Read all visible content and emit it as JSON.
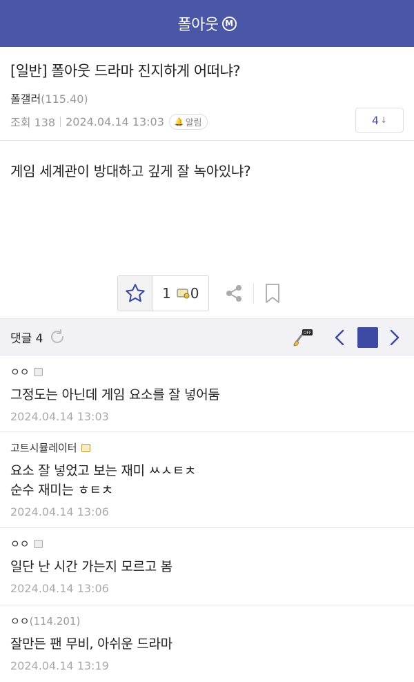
{
  "header": {
    "title": "폴아웃",
    "mark": "M"
  },
  "post": {
    "title": "[일반] 폴아웃 드라마 진지하게 어떠냐?",
    "author": "폴갤러",
    "author_ip": "(115.40)",
    "views": "조회 138",
    "datetime": "2024.04.14 13:03",
    "alarm_label": "알림",
    "reply_count": "4",
    "body": "게임 세계관이 방대하고 깊게 잘 녹아있냐?",
    "recommend_count": "1",
    "gallery_recommend_count": "0"
  },
  "comment_bar": {
    "label": "댓글 4"
  },
  "comments": [
    {
      "name": "ㅇㅇ",
      "ip": "",
      "lines": [
        "그정도는 아닌데 게임 요소를 잘 넣어둠"
      ],
      "date": "2024.04.14 13:03"
    },
    {
      "name": "고트시뮬레이터",
      "ip": "",
      "lines": [
        "요소 잘 넣었고 보는 재미 ㅆㅅㅌㅊ",
        "순수 재미는 ㅎㅌㅊ"
      ],
      "date": "2024.04.14 13:06"
    },
    {
      "name": "ㅇㅇ",
      "ip": "",
      "lines": [
        "일단 난 시간 가는지 모르고 봄"
      ],
      "date": "2024.04.14 13:06"
    },
    {
      "name": "ㅇㅇ",
      "ip": "(114.201)",
      "lines": [
        "잘만든 팬 무비, 아쉬운 드라마"
      ],
      "date": "2024.04.14 13:19"
    }
  ],
  "colors": {
    "brand": "#4a56a6",
    "accent": "#3c4aa3",
    "meta": "#999999"
  },
  "icons": [
    "star-icon",
    "gallery-recommend-icon",
    "share-icon",
    "bookmark-icon",
    "refresh-icon",
    "image-off-icon",
    "chevron-left-icon",
    "chevron-right-icon",
    "bell-icon"
  ]
}
